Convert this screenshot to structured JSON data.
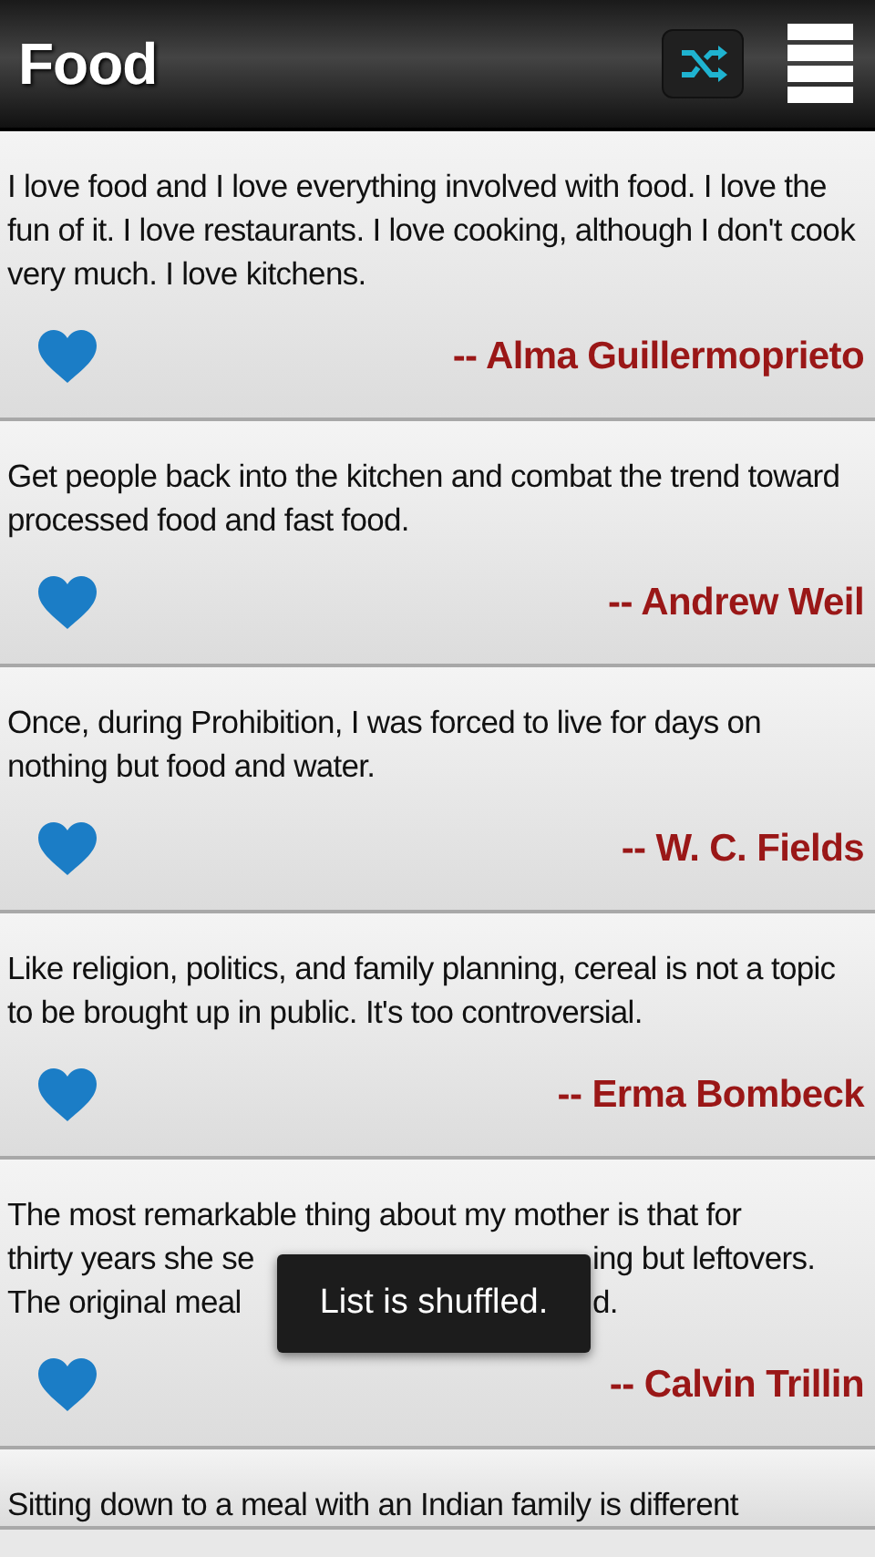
{
  "app_bar": {
    "title": "Food"
  },
  "quotes": [
    {
      "text": "I love food and I love everything involved with food. I love the fun of it. I love restaurants. I love cooking, although I don't cook very much. I love kitchens.",
      "author": "-- Alma Guillermoprieto"
    },
    {
      "text": "Get people back into the kitchen and combat the trend toward processed food and fast food.",
      "author": "-- Andrew Weil"
    },
    {
      "text": "Once, during Prohibition, I was forced to live for days on nothing but food and water.",
      "author": "-- W. C. Fields"
    },
    {
      "text": "Like religion, politics, and family planning, cereal is not a topic to be brought up in public. It's too controversial.",
      "author": "-- Erma Bombeck"
    },
    {
      "lines": [
        [
          "The most remarkable thing about my mother is that for"
        ],
        [
          "thirty years she se",
          "ing but leftovers."
        ],
        [
          "The original meal",
          "d."
        ]
      ],
      "author": "-- Calvin Trillin"
    },
    {
      "text": "Sitting down to a meal with an Indian family is different"
    }
  ],
  "toast": {
    "message": "List is shuffled."
  }
}
